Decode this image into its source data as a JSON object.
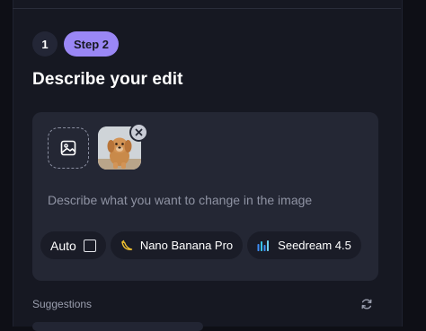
{
  "steps": {
    "current_number": "1",
    "active_label": "Step 2"
  },
  "title": "Describe your edit",
  "editor": {
    "upload_icon": "image-icon",
    "thumbnail_alt": "puppy photo",
    "prompt_placeholder": "Describe what you want to change in the image"
  },
  "models": {
    "auto_label": "Auto",
    "auto_checked": false,
    "items": [
      {
        "label": "Nano Banana Pro",
        "icon": "banana-icon"
      },
      {
        "label": "Seedream 4.5",
        "icon": "bars-icon"
      }
    ]
  },
  "suggestions": {
    "label": "Suggestions",
    "refresh_icon": "refresh-icon"
  },
  "colors": {
    "accent": "#9a87f5",
    "background": "#161822",
    "card": "#242734"
  }
}
